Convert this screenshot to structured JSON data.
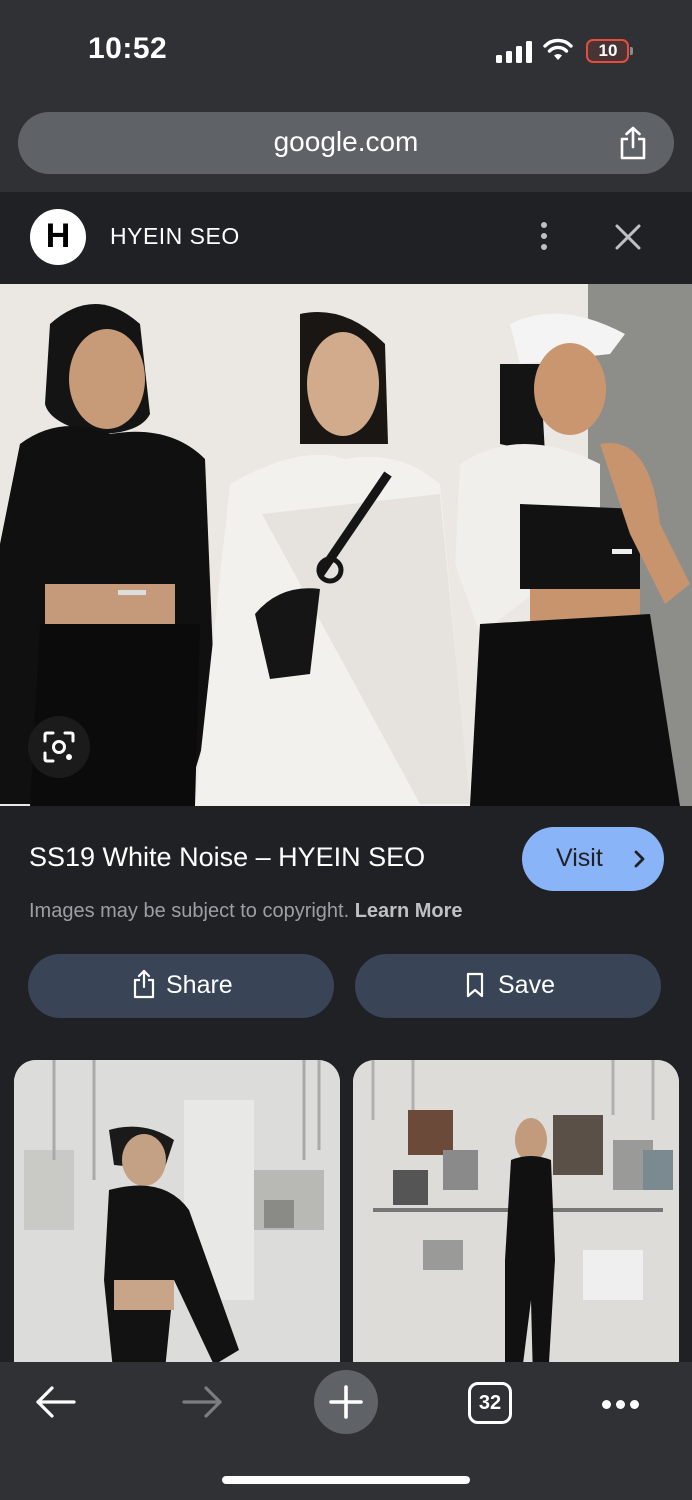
{
  "status_bar": {
    "time": "10:52",
    "battery": "10"
  },
  "browser": {
    "url": "google.com",
    "open_tabs": "32"
  },
  "site": {
    "logo_letter": "H",
    "name": "HYEIN SEO"
  },
  "result": {
    "title": "SS19 White Noise – HYEIN SEO",
    "visit_label": "Visit",
    "copyright_text": "Images may be subject to copyright.",
    "learn_more": "Learn More",
    "share_label": "Share",
    "save_label": "Save"
  },
  "icons": {
    "status": [
      "signal-icon",
      "wifi-icon",
      "battery-icon"
    ],
    "address_bar": [
      "share-icon"
    ],
    "header": [
      "more-vert-icon",
      "close-icon"
    ],
    "image": [
      "lens-icon"
    ],
    "toolbar": [
      "back-arrow-icon",
      "forward-arrow-icon",
      "plus-icon",
      "tabs-icon",
      "more-horiz-icon"
    ]
  },
  "colors": {
    "accent": "#8ab4f8",
    "button_bg": "#394457",
    "surface": "#202124",
    "toolbar": "#303134"
  }
}
